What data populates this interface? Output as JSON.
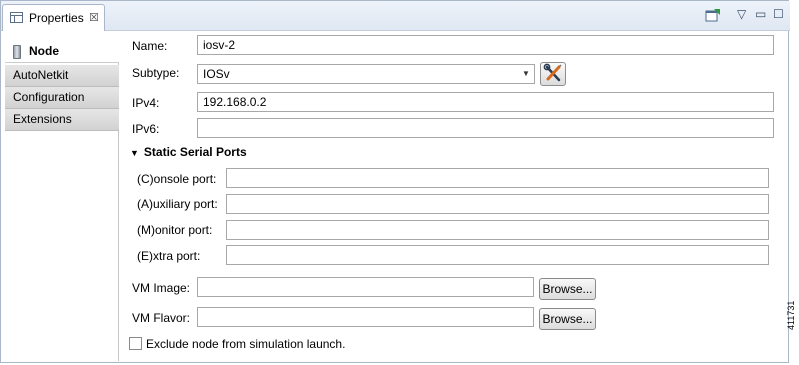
{
  "tab": {
    "title": "Properties",
    "close": "☒"
  },
  "toolbar": {
    "menu": "▽",
    "minimize": "▭",
    "maximize": "☐"
  },
  "sidebar": {
    "items": [
      {
        "label": "Node",
        "active": true
      },
      {
        "label": "AutoNetkit",
        "active": false
      },
      {
        "label": "Configuration",
        "active": false
      },
      {
        "label": "Extensions",
        "active": false
      }
    ]
  },
  "form": {
    "name_label": "Name:",
    "name_value": "iosv-2",
    "subtype_label": "Subtype:",
    "subtype_value": "IOSv",
    "ipv4_label": "IPv4:",
    "ipv4_value": "192.168.0.2",
    "ipv6_label": "IPv6:",
    "ipv6_value": ""
  },
  "serial_ports": {
    "title": "Static Serial Ports",
    "console_label": "(C)onsole port:",
    "console_value": "",
    "auxiliary_label": "(A)uxiliary port:",
    "auxiliary_value": "",
    "monitor_label": "(M)onitor port:",
    "monitor_value": "",
    "extra_label": "(E)xtra port:",
    "extra_value": ""
  },
  "vm": {
    "image_label": "VM Image:",
    "image_value": "",
    "flavor_label": "VM Flavor:",
    "flavor_value": "",
    "browse_label": "Browse..."
  },
  "exclude": {
    "label": "Exclude node from simulation launch.",
    "checked": false
  },
  "figure_number": "411731"
}
